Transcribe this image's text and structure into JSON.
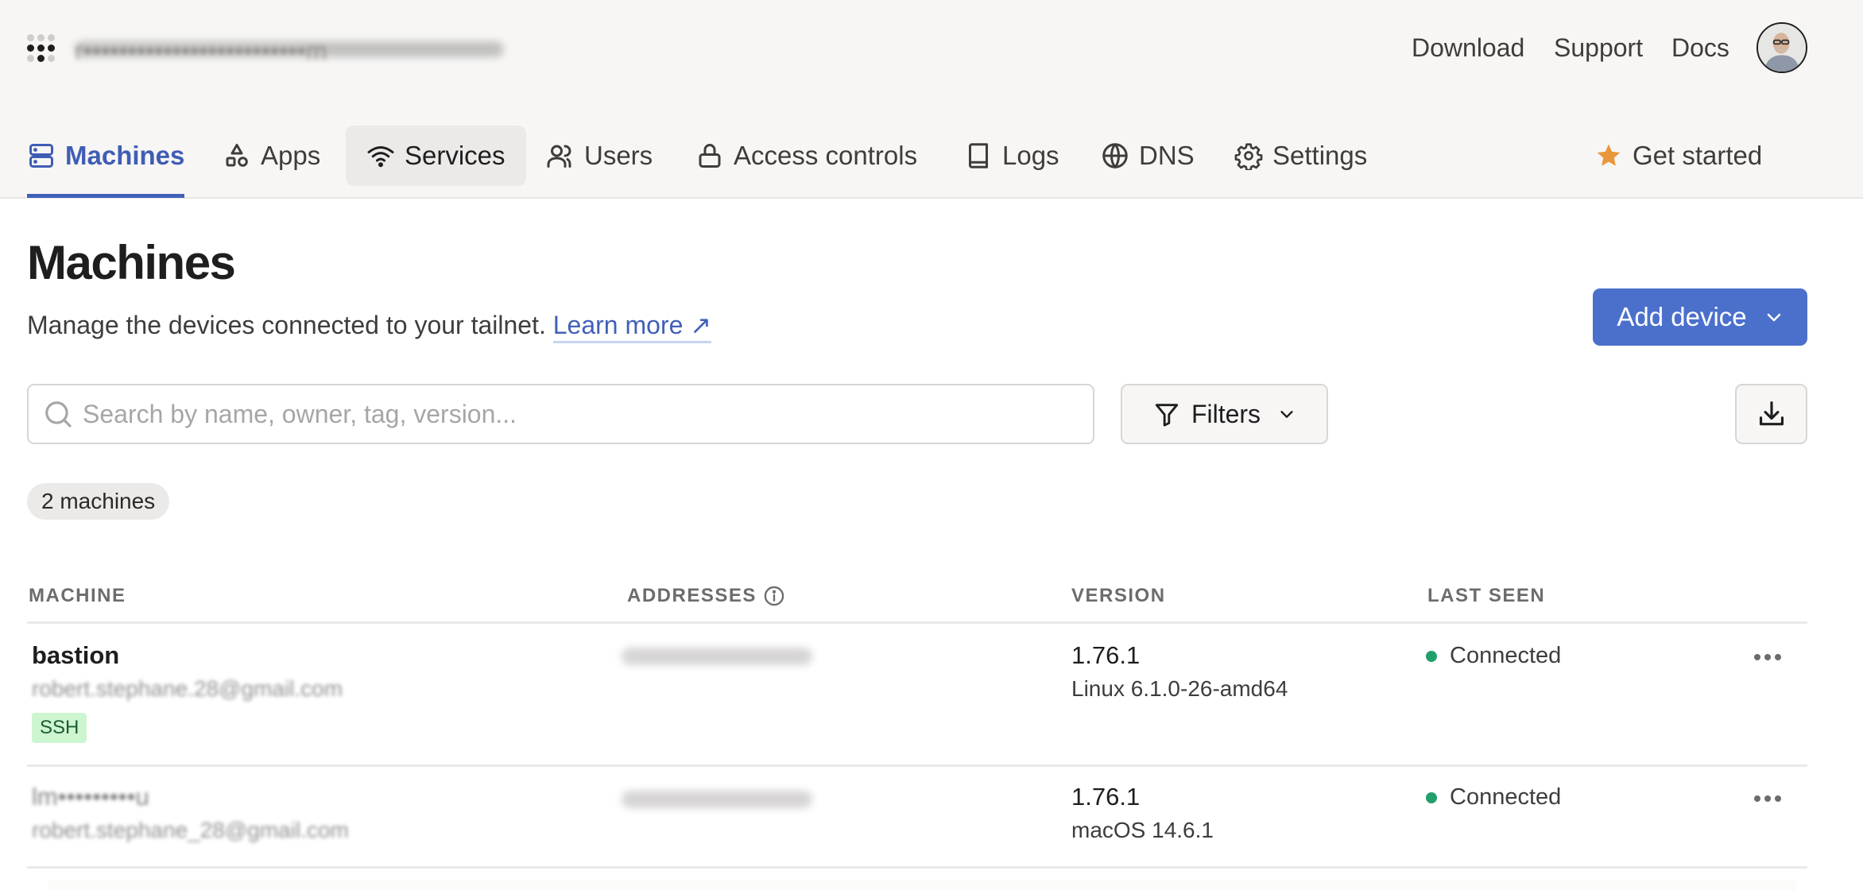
{
  "topbar": {
    "tailnet_name": "r•••••••••••••••••••••••••m",
    "links": [
      {
        "label": "Download"
      },
      {
        "label": "Support"
      },
      {
        "label": "Docs"
      }
    ],
    "avatar_alt": "User avatar"
  },
  "nav": {
    "tabs": [
      {
        "label": "Machines",
        "icon": "server-icon",
        "active": true
      },
      {
        "label": "Apps",
        "icon": "shapes-icon"
      },
      {
        "label": "Services",
        "icon": "wifi-icon",
        "hovered": true
      },
      {
        "label": "Users",
        "icon": "users-icon"
      },
      {
        "label": "Access controls",
        "icon": "lock-icon"
      },
      {
        "label": "Logs",
        "icon": "book-icon"
      },
      {
        "label": "DNS",
        "icon": "globe-icon"
      },
      {
        "label": "Settings",
        "icon": "gear-icon"
      }
    ],
    "get_started": {
      "label": "Get started",
      "icon": "star-icon",
      "icon_color": "#e8973a"
    }
  },
  "page": {
    "title": "Machines",
    "subtitle": "Manage the devices connected to your tailnet.",
    "learn_more": "Learn more ↗",
    "add_device": "Add device",
    "search_placeholder": "Search by name, owner, tag, version...",
    "search_value": "",
    "filters_label": "Filters",
    "export_label": "Export",
    "count_badge": "2 machines"
  },
  "table": {
    "columns": [
      "MACHINE",
      "ADDRESSES",
      "VERSION",
      "LAST SEEN"
    ],
    "rows": [
      {
        "name": "bastion",
        "owner": "robert.stephane.28@gmail.com",
        "tags": [
          "SSH"
        ],
        "address": "100.x.x.x",
        "version": "1.76.1",
        "os": "Linux 6.1.0-26-amd64",
        "status": "Connected"
      },
      {
        "name": "lm•••••••••u",
        "owner": "robert.stephane_28@gmail.com",
        "tags": [],
        "address": "100.x.x.x",
        "version": "1.76.1",
        "os": "macOS 14.6.1",
        "status": "Connected"
      }
    ]
  },
  "colors": {
    "accent": "#4061b8",
    "primary_button": "#4b70cc",
    "header_bg": "#f7f6f5",
    "status_connected": "#22a06b",
    "tag_bg": "#cdf5d0",
    "tag_text": "#1d5b31"
  }
}
